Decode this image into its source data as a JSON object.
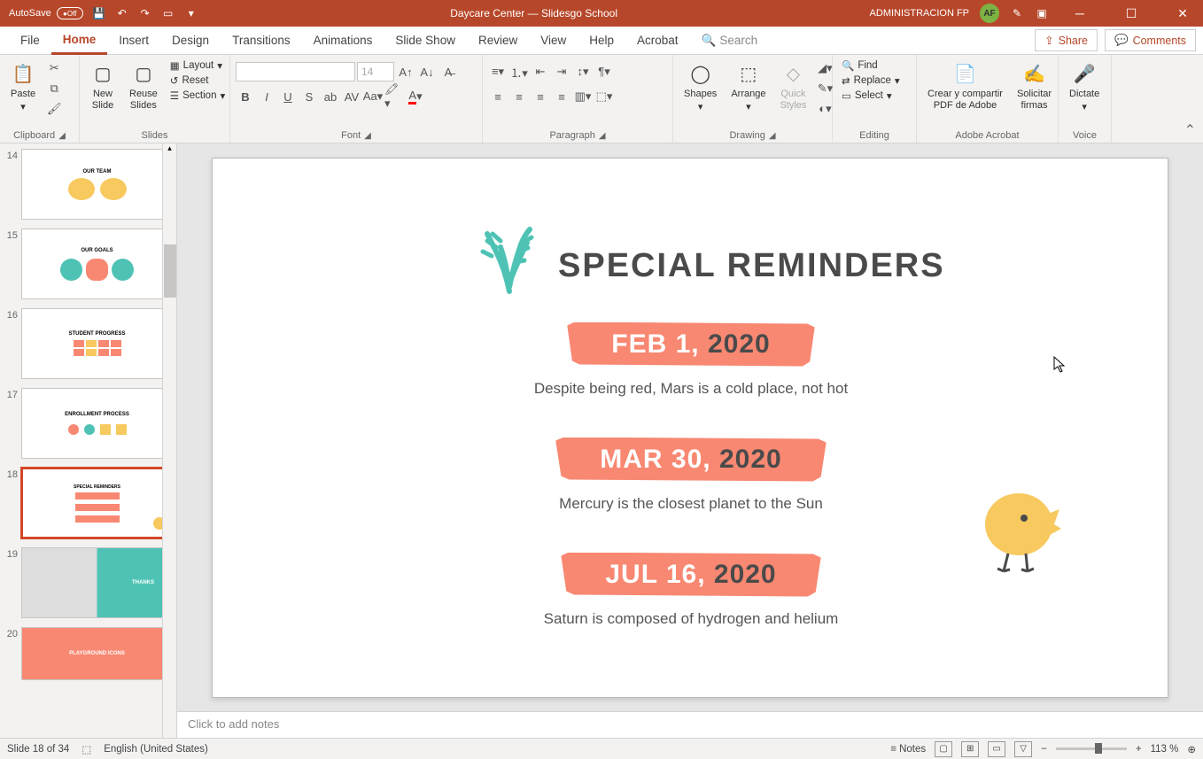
{
  "titlebar": {
    "autosave": "AutoSave",
    "toggle_state": "Off",
    "title": "Daycare Center — Slidesgo School",
    "user": "ADMINISTRACION FP",
    "user_initials": "AF"
  },
  "tabs": {
    "file": "File",
    "home": "Home",
    "insert": "Insert",
    "design": "Design",
    "transitions": "Transitions",
    "animations": "Animations",
    "slideshow": "Slide Show",
    "review": "Review",
    "view": "View",
    "help": "Help",
    "acrobat": "Acrobat",
    "search": "Search",
    "share": "Share",
    "comments": "Comments"
  },
  "ribbon": {
    "clipboard": {
      "label": "Clipboard",
      "paste": "Paste"
    },
    "slides": {
      "label": "Slides",
      "new": "New\nSlide",
      "reuse": "Reuse\nSlides",
      "layout": "Layout",
      "reset": "Reset",
      "section": "Section"
    },
    "font": {
      "label": "Font",
      "size": "14"
    },
    "paragraph": {
      "label": "Paragraph"
    },
    "drawing": {
      "label": "Drawing",
      "shapes": "Shapes",
      "arrange": "Arrange",
      "quick": "Quick\nStyles"
    },
    "editing": {
      "label": "Editing",
      "find": "Find",
      "replace": "Replace",
      "select": "Select"
    },
    "acrobat": {
      "label": "Adobe Acrobat",
      "create": "Crear y compartir\nPDF de Adobe",
      "request": "Solicitar\nfirmas"
    },
    "voice": {
      "label": "Voice",
      "dictate": "Dictate"
    }
  },
  "thumbs": [
    {
      "num": "14",
      "title": "OUR TEAM"
    },
    {
      "num": "15",
      "title": "OUR GOALS"
    },
    {
      "num": "16",
      "title": "STUDENT PROGRESS"
    },
    {
      "num": "17",
      "title": "ENROLLMENT PROCESS"
    },
    {
      "num": "18",
      "title": "SPECIAL REMINDERS",
      "selected": true
    },
    {
      "num": "19",
      "title": "THANKS"
    },
    {
      "num": "20",
      "title": "PLAYGROUND ICONS"
    }
  ],
  "slide": {
    "title": "SPECIAL REMINDERS",
    "items": [
      {
        "date_pre": "FEB 1,",
        "year": " 2020",
        "text": "Despite being red, Mars is a cold place, not hot"
      },
      {
        "date_pre": "MAR 30,",
        "year": " 2020",
        "text": "Mercury is the closest planet to the Sun"
      },
      {
        "date_pre": "JUL 16,",
        "year": " 2020",
        "text": "Saturn is composed of hydrogen and helium"
      }
    ]
  },
  "notes": {
    "placeholder": "Click to add notes"
  },
  "status": {
    "slide": "Slide 18 of 34",
    "lang": "English (United States)",
    "notes": "Notes",
    "zoom": "113 %"
  }
}
